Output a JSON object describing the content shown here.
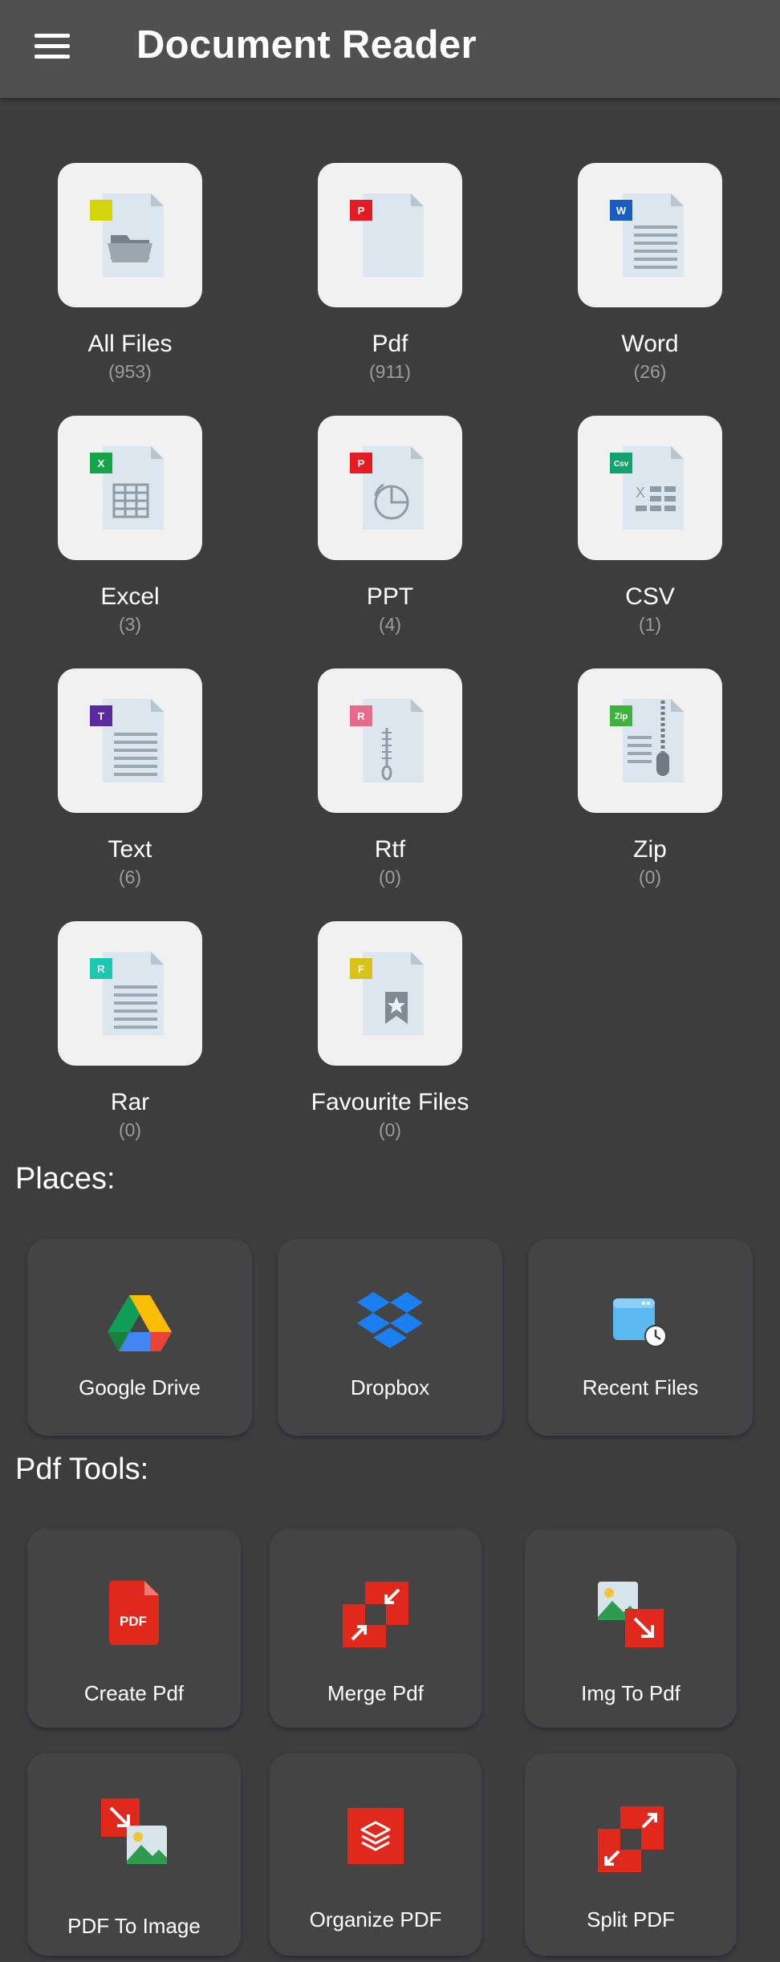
{
  "header": {
    "title": "Document Reader",
    "menu_icon": "hamburger-menu-icon"
  },
  "categories": [
    {
      "label": "All Files",
      "count": "(953)",
      "badge": "",
      "badge_color": "#d4d40c",
      "icon": "folder-doc-icon"
    },
    {
      "label": "Pdf",
      "count": "(911)",
      "badge": "P",
      "badge_color": "#e31b23",
      "icon": "pdf-doc-icon"
    },
    {
      "label": "Word",
      "count": "(26)",
      "badge": "W",
      "badge_color": "#1a5dc0",
      "icon": "word-doc-icon"
    },
    {
      "label": "Excel",
      "count": "(3)",
      "badge": "X",
      "badge_color": "#16a34a",
      "icon": "excel-doc-icon"
    },
    {
      "label": "PPT",
      "count": "(4)",
      "badge": "P",
      "badge_color": "#e31b23",
      "icon": "ppt-doc-icon"
    },
    {
      "label": "CSV",
      "count": "(1)",
      "badge": "Csv",
      "badge_color": "#10a36b",
      "icon": "csv-doc-icon"
    },
    {
      "label": "Text",
      "count": "(6)",
      "badge": "T",
      "badge_color": "#5b2a9e",
      "icon": "text-doc-icon"
    },
    {
      "label": "Rtf",
      "count": "(0)",
      "badge": "R",
      "badge_color": "#e86a8a",
      "icon": "rtf-doc-icon"
    },
    {
      "label": "Zip",
      "count": "(0)",
      "badge": "Zip",
      "badge_color": "#3db33d",
      "icon": "zip-doc-icon"
    },
    {
      "label": "Rar",
      "count": "(0)",
      "badge": "R",
      "badge_color": "#1ec7b0",
      "icon": "rar-doc-icon"
    },
    {
      "label": "Favourite Files",
      "count": "(0)",
      "badge": "F",
      "badge_color": "#d9c21a",
      "icon": "favourite-doc-icon"
    }
  ],
  "places": {
    "title": "Places:",
    "items": [
      {
        "label": "Google Drive",
        "icon": "google-drive-icon"
      },
      {
        "label": "Dropbox",
        "icon": "dropbox-icon"
      },
      {
        "label": "Recent Files",
        "icon": "recent-files-icon"
      }
    ]
  },
  "pdf_tools": {
    "title": "Pdf Tools:",
    "items": [
      {
        "label": "Create Pdf",
        "icon": "create-pdf-icon",
        "badge": "PDF"
      },
      {
        "label": "Merge Pdf",
        "icon": "merge-pdf-icon"
      },
      {
        "label": "Img To Pdf",
        "icon": "img-to-pdf-icon"
      },
      {
        "label": "PDF To Image",
        "icon": "pdf-to-image-icon"
      },
      {
        "label": "Organize PDF",
        "icon": "organize-pdf-icon"
      },
      {
        "label": "Split PDF",
        "icon": "split-pdf-icon"
      }
    ]
  },
  "colors": {
    "background": "#3d3d3d",
    "appbar": "#505050",
    "tile": "#f1f1f1",
    "card": "#444444",
    "accent_red": "#e0281c"
  }
}
